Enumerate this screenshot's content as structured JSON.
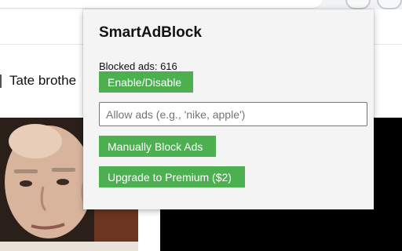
{
  "background": {
    "headline": "Tate brothe"
  },
  "popup": {
    "title": "SmartAdBlock",
    "blocked_label": "Blocked ads:",
    "blocked_count": "616",
    "toggle_label": "Enable/Disable",
    "allow_placeholder": "Allow ads (e.g., 'nike, apple')",
    "allow_value": "",
    "manual_label": "Manually Block Ads",
    "upgrade_label": "Upgrade to Premium ($2)"
  },
  "colors": {
    "accent": "#4caf50",
    "popup_bg": "#f4f4f4"
  }
}
